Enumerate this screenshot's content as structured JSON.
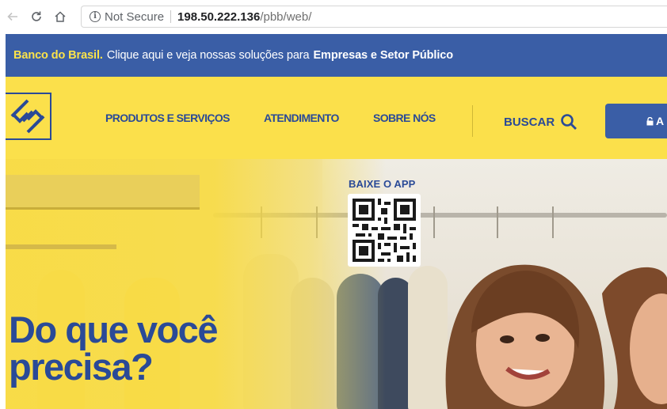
{
  "browser": {
    "security_label": "Not Secure",
    "url_host": "198.50.222.136",
    "url_path": "/pbb/web/"
  },
  "promo": {
    "brand": "Banco do Brasil.",
    "text": "Clique aqui e veja nossas soluções para",
    "highlight": "Empresas e Setor Público"
  },
  "header": {
    "nav": [
      "PRODUTOS E SERVIÇOS",
      "ATENDIMENTO",
      "SOBRE NÓS"
    ],
    "search_label": "BUSCAR",
    "login_label": "A"
  },
  "hero": {
    "app_label": "BAIXE O APP",
    "title_line1": "Do que você",
    "title_line2": "precisa?"
  },
  "colors": {
    "brand_blue": "#2a4a97",
    "promo_blue": "#3a5ea6",
    "brand_yellow": "#fbe04b"
  },
  "icons": {
    "back": "arrow-left-icon",
    "reload": "reload-icon",
    "home": "home-icon",
    "info": "info-icon",
    "search": "search-icon",
    "lock": "lock-icon",
    "logo": "banco-do-brasil-logo",
    "qr": "qr-code"
  }
}
